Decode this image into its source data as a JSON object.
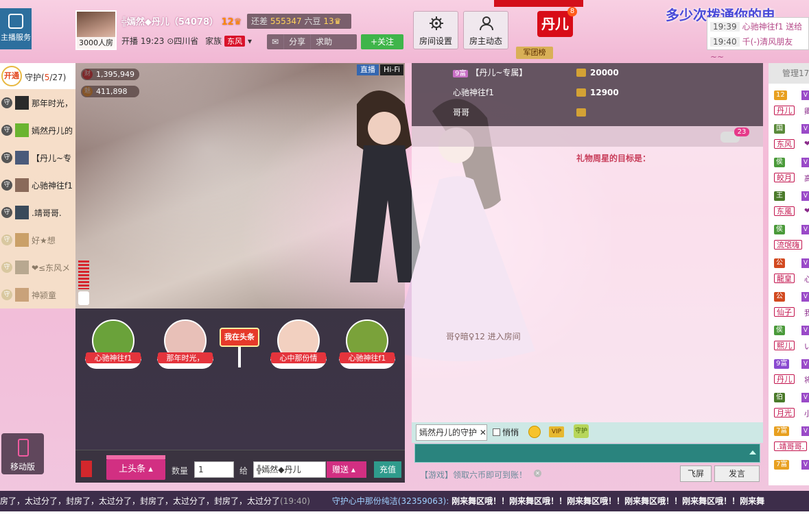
{
  "header": {
    "host_service": "主播服务",
    "avatar_caption": "3000人房",
    "host_name": "╬嫣然◆丹儿（54078）",
    "host_level": "12",
    "bean_text": "还差",
    "bean_value": "555347",
    "bean_suffix": "六豆",
    "next_level": "13",
    "live_info": "开播 19:23",
    "location": "四川省",
    "family_label": "家族",
    "family_tag": "东风",
    "share": "分享",
    "help": "求助",
    "follow": "+关注",
    "room_settings": "房间设置",
    "host_feed": "房主动态",
    "danger_logo": "丹儿",
    "danger_badge": "8",
    "army": "军团榜",
    "marquee": "多少次拨通你的电",
    "notice": [
      {
        "time": "19:39",
        "msg": "心驰神往f1 送给"
      },
      {
        "time": "19:40",
        "msg": "千(-)清风朋友~~"
      }
    ]
  },
  "guard": {
    "open_label": "开通",
    "title": "守护",
    "count_current": "5",
    "count_total": "27",
    "members": [
      {
        "name": "那年时光，",
        "active": true
      },
      {
        "name": "嫣然丹儿的",
        "active": true
      },
      {
        "name": "【丹儿~专",
        "active": true
      },
      {
        "name": "心驰神往f1",
        "active": true
      },
      {
        "name": ".靖哥哥.",
        "active": true
      },
      {
        "name": "好★想",
        "active": false
      },
      {
        "name": "❤≤东风メ",
        "active": false
      },
      {
        "name": "神颍童",
        "active": false
      }
    ]
  },
  "video": {
    "wealth": "1,395,949",
    "charm": "411,898",
    "live_tag": "直播",
    "hifi_tag": "Hi-Fi"
  },
  "gifts": [
    {
      "label": "心驰神往f1"
    },
    {
      "label": "那年时光，"
    },
    {
      "label": "我在头条"
    },
    {
      "label": "心中那份情"
    },
    {
      "label": "心驰神往f1"
    }
  ],
  "gift_bar": {
    "headline": "上头条",
    "qty_label": "数量",
    "qty_value": "1",
    "to_label": "给",
    "to_value": "╬嫣然◆丹儿",
    "send": "赠送",
    "recharge": "充值"
  },
  "rank": [
    {
      "tag": "9富",
      "name": "【丹儿~专属】",
      "score": "20000"
    },
    {
      "tag": "",
      "name": "心驰神往f1",
      "score": "12900"
    },
    {
      "tag": "",
      "name": "哥哥",
      "score": ""
    }
  ],
  "chat": {
    "tab_badge": "23",
    "weekly_goal": "礼物周星的目标是：",
    "enter_msg": "哥♀暗♀12 进入房间",
    "target": "嫣然丹儿的守护",
    "whisper": "悄悄",
    "vip": "VIP",
    "guard_emote": "守护",
    "game_hint": "【游戏】领取六币即可到账！",
    "flyscreen": "飞屏",
    "send": "发言"
  },
  "managers": {
    "title": "管理17",
    "rows": [
      {
        "badge": "12",
        "name": "丹儿",
        "extra": "卿"
      },
      {
        "badge": "国",
        "name": "东风",
        "extra": "❤"
      },
      {
        "badge": "侯",
        "name": "皎月",
        "extra": "高"
      },
      {
        "badge": "王",
        "name": "东風",
        "extra": "❤"
      },
      {
        "badge": "侯",
        "name": "流氓嗨",
        "extra": ""
      },
      {
        "badge": "公",
        "name": "龍皇",
        "extra": "心"
      },
      {
        "badge": "公",
        "name": "仙子",
        "extra": "我"
      },
      {
        "badge": "侯",
        "name": "熙儿",
        "extra": "い"
      },
      {
        "badge": "9富",
        "name": "丹儿",
        "extra": "将"
      },
      {
        "badge": "伯",
        "name": "月光",
        "extra": "小"
      },
      {
        "badge": "7富",
        "name": ".靖哥哥.",
        "extra": ""
      },
      {
        "badge": "7富",
        "name": "",
        "extra": ""
      }
    ]
  },
  "mobile": "移动版",
  "ticker": {
    "text1": "房了，太过分了，封房了，太过分了，封房了，太过分了，封房了，太过分了",
    "time1": "(19:40)",
    "text2": "守护心中那份纯洁(32359063):",
    "text3": "刚来舞区哦！！刚来舞区哦！！刚来舞区哦！！刚来舞区哦！！刚来舞区哦！！刚来舞"
  },
  "colors": {
    "accent": "#d22f82",
    "follow": "#3fb54a",
    "recharge": "#2f9b8c",
    "family": "#d9122b"
  }
}
